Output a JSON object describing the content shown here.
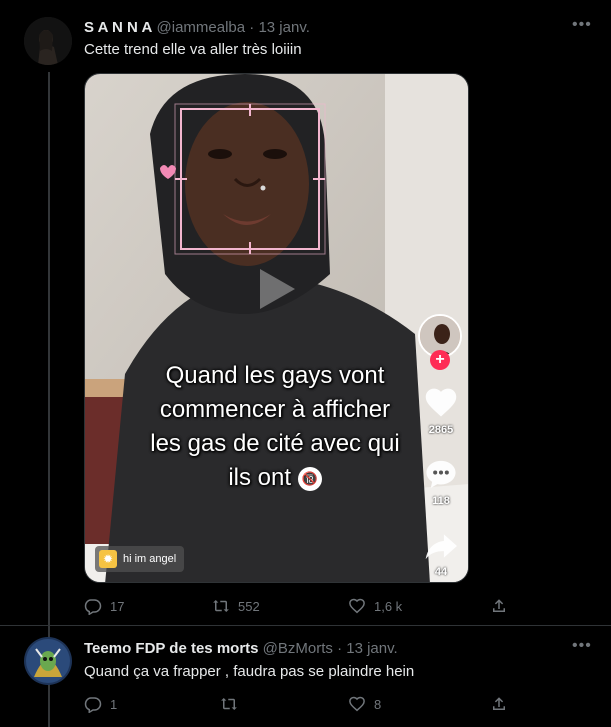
{
  "tweets": [
    {
      "name": "S A N N A",
      "handle": "@iammealba",
      "date": "· 13 janv.",
      "text": "Cette trend elle va aller très loiiin",
      "replies": "17",
      "retweets": "552",
      "likes": "1,6 k",
      "media": {
        "caption": "Quand les gays vont commencer à afficher les gas de cité avec qui ils ont",
        "caption_lines": [
          "Quand les gays vont",
          "commencer à afficher",
          "les gas de cité avec qui",
          "ils ont"
        ],
        "badge": "🔞",
        "likes": "2865",
        "comments": "118",
        "shares": "44",
        "creator_label": "hi im angel"
      }
    },
    {
      "name": "Teemo FDP de tes morts",
      "handle": "@BzMorts",
      "date": "· 13 janv.",
      "text": "Quand ça va frapper , faudra pas se plaindre hein",
      "replies": "1",
      "retweets": "",
      "likes": "8"
    }
  ],
  "colors": {
    "background": "#000000",
    "text": "#e7e9ea",
    "muted": "#71767b",
    "border": "#2f3336",
    "tiktok_red": "#fe2c55"
  }
}
